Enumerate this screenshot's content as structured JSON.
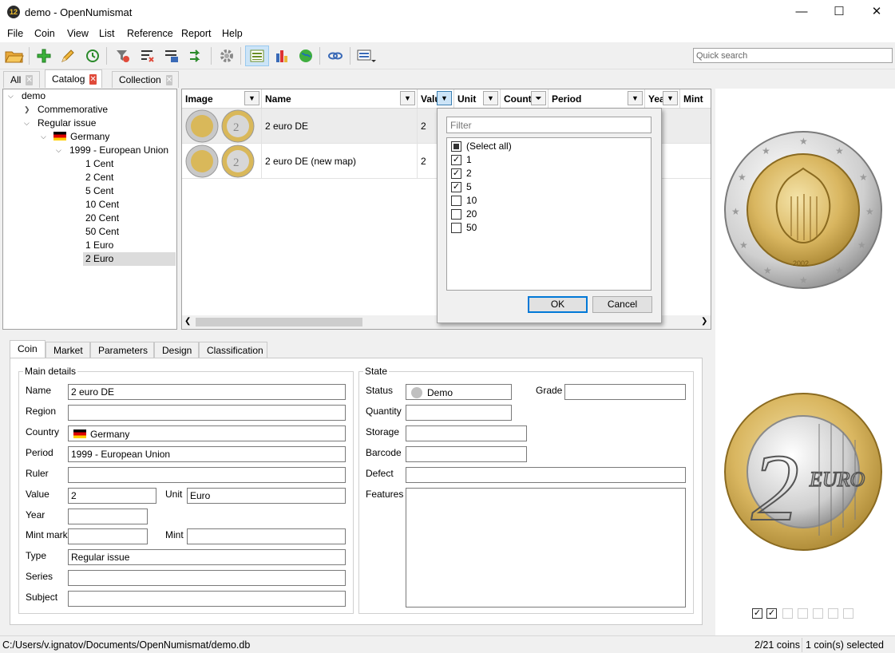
{
  "window": {
    "title": "demo - OpenNumismat",
    "icon_text": "12"
  },
  "menu": [
    "File",
    "Coin",
    "View",
    "List",
    "Reference",
    "Report",
    "Help"
  ],
  "toolbar": {
    "search_placeholder": "Quick search"
  },
  "tabs": [
    {
      "label": "All",
      "active": false
    },
    {
      "label": "Catalog",
      "active": true
    },
    {
      "label": "Collection",
      "active": false
    }
  ],
  "tree": {
    "root": "demo",
    "commemorative": "Commemorative",
    "regular": "Regular issue",
    "country": "Germany",
    "period": "1999 - European Union",
    "values": [
      "1 Cent",
      "2 Cent",
      "5 Cent",
      "10 Cent",
      "20 Cent",
      "50 Cent",
      "1 Euro",
      "2 Euro"
    ],
    "selected": "2 Euro"
  },
  "grid": {
    "columns": [
      "Image",
      "Name",
      "Value",
      "Unit",
      "Country",
      "Period",
      "Year",
      "Mint"
    ],
    "rows": [
      {
        "name": "2 euro DE",
        "value": "2"
      },
      {
        "name": "2 euro DE (new map)",
        "value": "2"
      }
    ]
  },
  "filter": {
    "placeholder": "Filter",
    "items": [
      {
        "label": "(Select all)",
        "state": "partial"
      },
      {
        "label": "1",
        "state": "checked"
      },
      {
        "label": "2",
        "state": "checked"
      },
      {
        "label": "5",
        "state": "checked"
      },
      {
        "label": "10",
        "state": "unchecked"
      },
      {
        "label": "20",
        "state": "unchecked"
      },
      {
        "label": "50",
        "state": "unchecked"
      }
    ],
    "ok": "OK",
    "cancel": "Cancel"
  },
  "details": {
    "tabs": [
      "Coin",
      "Market",
      "Parameters",
      "Design",
      "Classification"
    ],
    "main_title": "Main details",
    "state_title": "State",
    "labels": {
      "name": "Name",
      "region": "Region",
      "country": "Country",
      "period": "Period",
      "ruler": "Ruler",
      "value": "Value",
      "unit": "Unit",
      "year": "Year",
      "mintmark": "Mint mark",
      "mint": "Mint",
      "type": "Type",
      "series": "Series",
      "subject": "Subject",
      "status": "Status",
      "grade": "Grade",
      "quantity": "Quantity",
      "storage": "Storage",
      "barcode": "Barcode",
      "defect": "Defect",
      "features": "Features"
    },
    "values": {
      "name": "2 euro DE",
      "country": "Germany",
      "period": "1999 - European Union",
      "value": "2",
      "unit": "Euro",
      "type": "Regular issue",
      "status": "Demo"
    }
  },
  "preview": {
    "obverse_year": "2002",
    "reverse_text": "EURO",
    "reverse_digit": "2"
  },
  "status": {
    "path": "C:/Users/v.ignatov/Documents/OpenNumismat/demo.db",
    "count": "2/21 coins",
    "selected": "1 coin(s) selected"
  },
  "colors": {
    "accent": "#0078d7",
    "selection": "#cce4f7",
    "flag_black": "#000000",
    "flag_red": "#dd0000",
    "flag_gold": "#ffce00"
  }
}
